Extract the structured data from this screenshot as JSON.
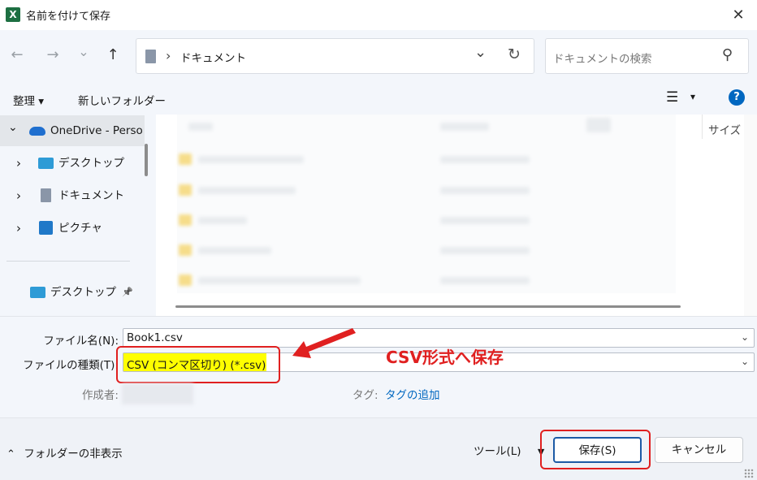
{
  "window": {
    "title": "名前を付けて保存",
    "close_glyph": "✕"
  },
  "nav": {
    "back_glyph": "←",
    "forward_glyph": "→",
    "recent_glyph": "⌄",
    "up_glyph": "↑",
    "breadcrumb_sep": "›",
    "breadcrumb": "ドキュメント",
    "addr_chevron": "⌄",
    "refresh_glyph": "↻",
    "search_placeholder": "ドキュメントの検索",
    "search_glyph": "⚲"
  },
  "toolbar": {
    "organize_label": "整理 ▾",
    "new_folder_label": "新しいフォルダー",
    "view_glyph": "☰",
    "view_chevron": "▾",
    "help_glyph": "?"
  },
  "sidebar": {
    "onedrive_expand": "⌄",
    "onedrive_label": "OneDrive - Perso",
    "items": [
      {
        "chevron": "›",
        "label": "デスクトップ"
      },
      {
        "chevron": "›",
        "label": "ドキュメント"
      },
      {
        "chevron": "›",
        "label": "ピクチャ"
      }
    ],
    "quick_access": {
      "label": "デスクトップ",
      "pin_glyph": "📌"
    }
  },
  "filepane": {
    "size_header": "サイズ"
  },
  "form": {
    "filename_label": "ファイル名(N):",
    "filename_value": "Book1.csv",
    "filetype_label": "ファイルの種類(T):",
    "filetype_value": "CSV (コンマ区切り) (*.csv)",
    "combo_chevron": "⌄",
    "author_label": "作成者:",
    "tags_label": "タグ:",
    "tags_value": "タグの追加"
  },
  "annotation": {
    "text": "CSV形式へ保存",
    "color": "#e02020"
  },
  "footer": {
    "hide_folders_glyph": "⌃",
    "hide_folders_label": "フォルダーの非表示",
    "tools_label": "ツール(L)",
    "tools_arrow": "▼",
    "save_label": "保存(S)",
    "cancel_label": "キャンセル"
  },
  "colors": {
    "accent": "#0067c0",
    "highlight": "#ffff00",
    "annotation_red": "#e02020",
    "excel_green": "#1d6f42"
  }
}
